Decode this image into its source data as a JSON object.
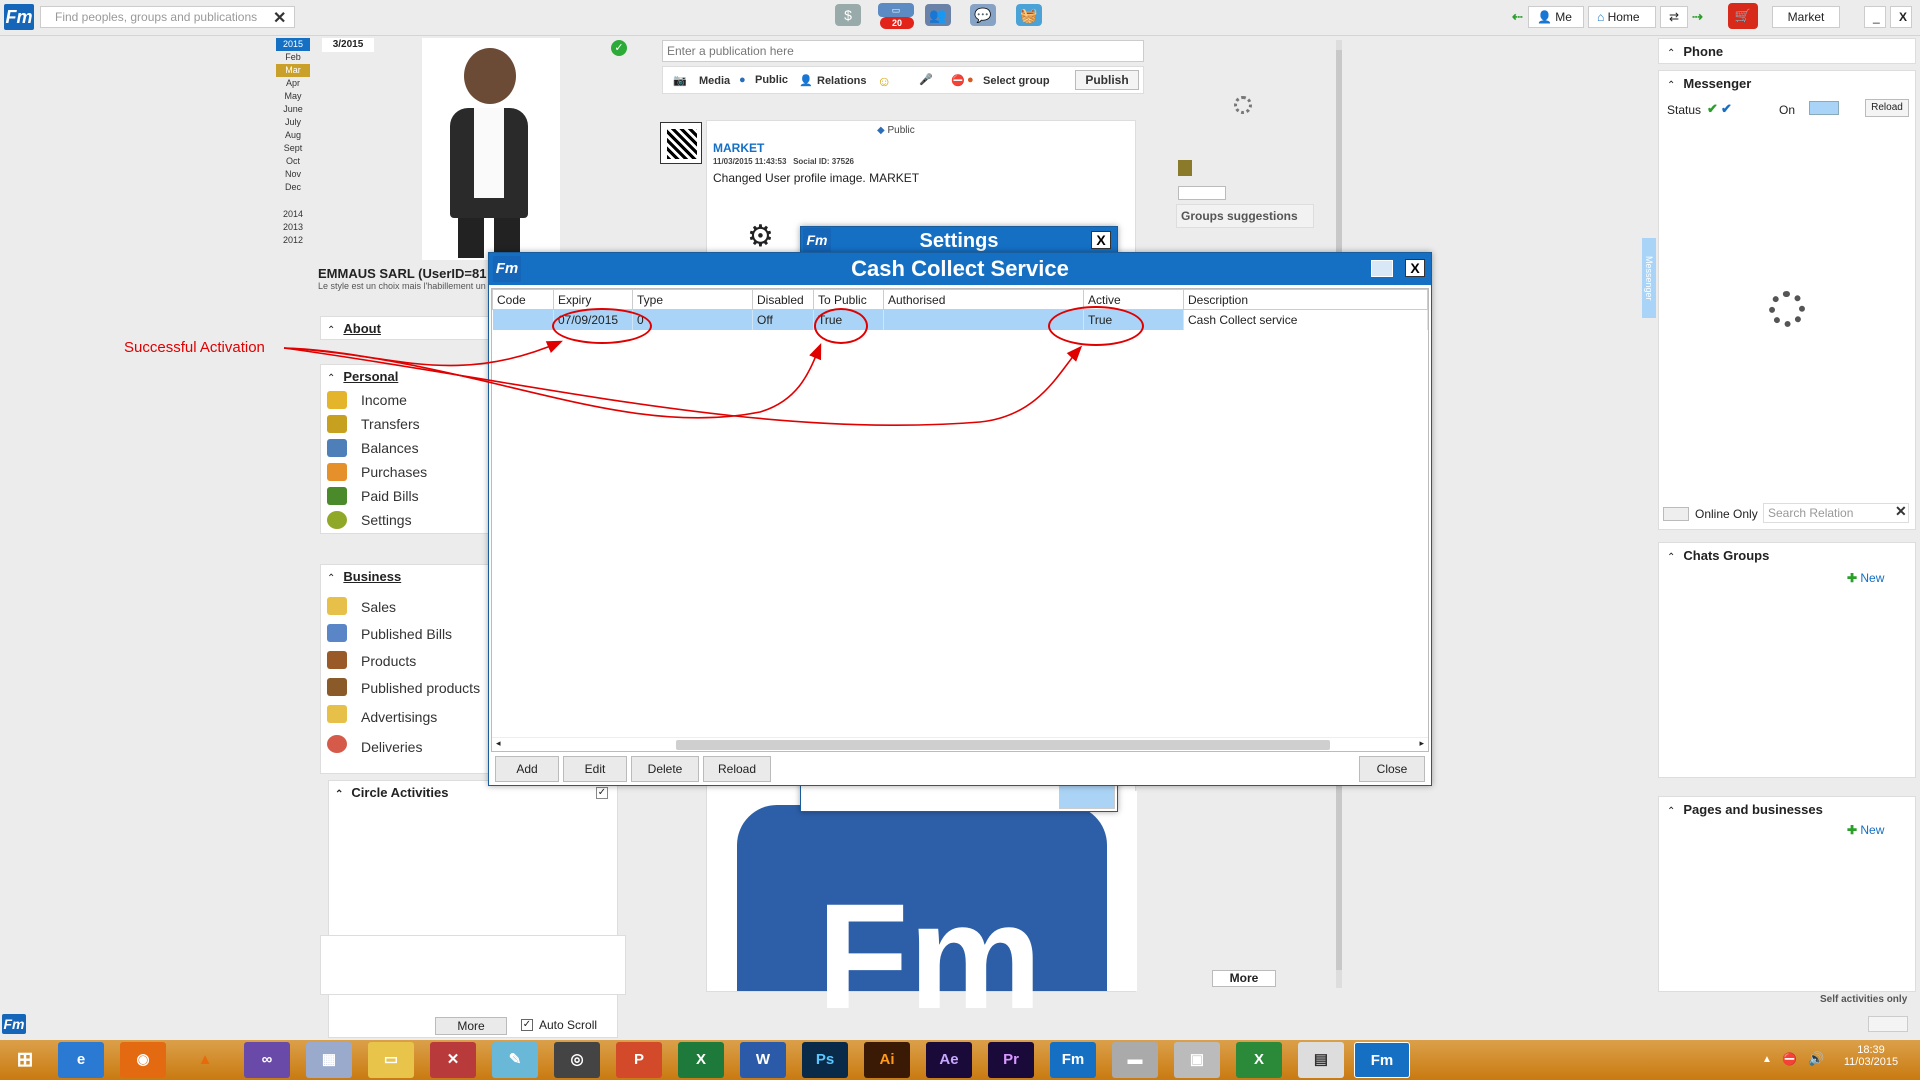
{
  "app": {
    "logo": "Fm"
  },
  "topbar": {
    "search_placeholder": "Find peoples, groups and publications",
    "notifications_badge": "20",
    "me_label": "Me",
    "home_label": "Home",
    "market_label": "Market",
    "minimize": "_",
    "close": "X"
  },
  "calendar": {
    "current": "3/2015",
    "year_selected": "2015",
    "months": [
      "Feb",
      "Mar",
      "Apr",
      "May",
      "June",
      "July",
      "Aug",
      "Sept",
      "Oct",
      "Nov",
      "Dec"
    ],
    "selected_month": "Mar",
    "years": [
      "2014",
      "2013",
      "2012"
    ]
  },
  "profile": {
    "name": "EMMAUS SARL (UserID=81",
    "tagline": "Le style est un choix mais l'habillement un"
  },
  "left_menu": {
    "about": "About",
    "personal": {
      "title": "Personal",
      "items": [
        "Income",
        "Transfers",
        "Balances",
        "Purchases",
        "Paid Bills",
        "Settings"
      ]
    },
    "business": {
      "title": "Business",
      "items": [
        "Sales",
        "Published Bills",
        "Products",
        "Published products",
        "Advertisings",
        "Deliveries"
      ]
    },
    "circle": {
      "title": "Circle Activities",
      "more": "More",
      "auto_scroll": "Auto Scroll"
    }
  },
  "annotation": {
    "label": "Successful Activation"
  },
  "publish": {
    "placeholder": "Enter a publication here",
    "media": "Media",
    "public": "Public",
    "relations": "Relations",
    "select_group": "Select group",
    "publish_btn": "Publish"
  },
  "post": {
    "visibility": "Public",
    "author": "MARKET",
    "meta": "11/03/2015 11:43:53   Social ID: 37526",
    "text": "Changed User profile image. MARKET"
  },
  "suggestions": {
    "groups": "Groups suggestions",
    "more": "More"
  },
  "settings_window": {
    "title": "Settings",
    "close": "X"
  },
  "ccs_window": {
    "title": "Cash Collect Service",
    "close": "X",
    "columns": [
      "Code",
      "Expiry",
      "Type",
      "Disabled",
      "To Public",
      "Authorised",
      "Active",
      "Description"
    ],
    "rows": [
      {
        "code": "",
        "expiry": "07/09/2015",
        "type": "0",
        "disabled": "Off",
        "to_public": "True",
        "authorised": "",
        "active": "True",
        "description": "Cash Collect service"
      }
    ],
    "buttons": {
      "add": "Add",
      "edit": "Edit",
      "delete": "Delete",
      "reload": "Reload",
      "close": "Close"
    }
  },
  "right": {
    "phone": "Phone",
    "messenger": "Messenger",
    "status": "Status",
    "on": "On",
    "reload": "Reload",
    "online_only": "Online Only",
    "search_relation": "Search Relation",
    "chats_groups": "Chats Groups",
    "new": "New",
    "pages_businesses": "Pages and businesses",
    "self_activities": "Self activities only",
    "side_tab": "Messenger"
  },
  "taskbar": {
    "time": "18:39",
    "date": "11/03/2015",
    "apps": [
      "IE",
      "Firefox",
      "VLC",
      "VS",
      "Calc",
      "Files",
      "Tool",
      "Note",
      "Cam",
      "PowerPoint",
      "Excel",
      "Word",
      "Photoshop",
      "Illustrator",
      "After Effects",
      "Premiere",
      "Fm",
      "Drive",
      "Img",
      "Excel2",
      "Win",
      "Fm2"
    ]
  },
  "colors": {
    "accent": "#1570c4",
    "selection": "#a9d4f7",
    "annotation": "#e00000",
    "taskbar": "#d08a1a"
  }
}
